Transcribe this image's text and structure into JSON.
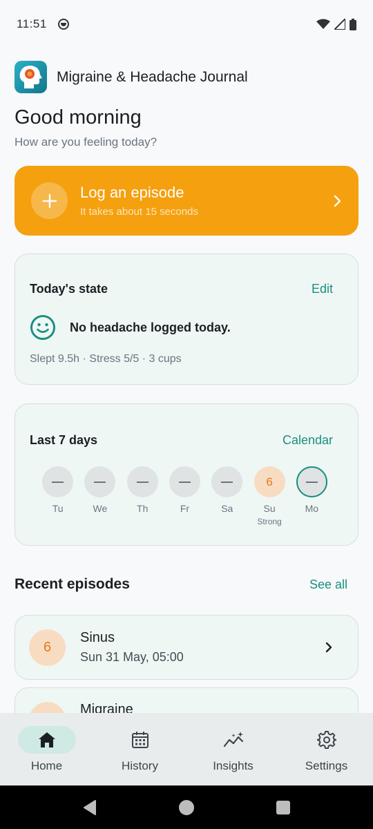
{
  "status_bar": {
    "time": "11:51"
  },
  "app": {
    "title": "Migraine & Headache Journal"
  },
  "greeting": {
    "title": "Good morning",
    "subtitle": "How are you feeling today?"
  },
  "log_card": {
    "title": "Log an episode",
    "subtitle": "It takes about 15 seconds"
  },
  "today": {
    "title": "Today's state",
    "edit_label": "Edit",
    "message": "No headache logged today.",
    "meta": "Slept 9.5h · Stress 5/5 · 3 cups"
  },
  "week": {
    "title": "Last 7 days",
    "calendar_label": "Calendar",
    "days": [
      {
        "label": "Tu",
        "value": "",
        "sub": ""
      },
      {
        "label": "We",
        "value": "",
        "sub": ""
      },
      {
        "label": "Th",
        "value": "",
        "sub": ""
      },
      {
        "label": "Fr",
        "value": "",
        "sub": ""
      },
      {
        "label": "Sa",
        "value": "",
        "sub": ""
      },
      {
        "label": "Su",
        "value": "6",
        "sub": "Strong"
      },
      {
        "label": "Mo",
        "value": "",
        "sub": ""
      }
    ]
  },
  "recent": {
    "title": "Recent episodes",
    "see_all_label": "See all",
    "episodes": [
      {
        "severity": "6",
        "title": "Sinus",
        "date": "Sun 31 May, 05:00"
      },
      {
        "severity": "",
        "title": "Migraine",
        "date": ""
      }
    ]
  },
  "nav": {
    "items": [
      {
        "label": "Home",
        "icon": "home-icon"
      },
      {
        "label": "History",
        "icon": "calendar-icon"
      },
      {
        "label": "Insights",
        "icon": "insights-icon"
      },
      {
        "label": "Settings",
        "icon": "gear-icon"
      }
    ]
  },
  "colors": {
    "accent": "#1a8f7e",
    "log_card": "#f5a00f",
    "severity_bg": "#f8dcc1",
    "severity_text": "#e6771e"
  }
}
